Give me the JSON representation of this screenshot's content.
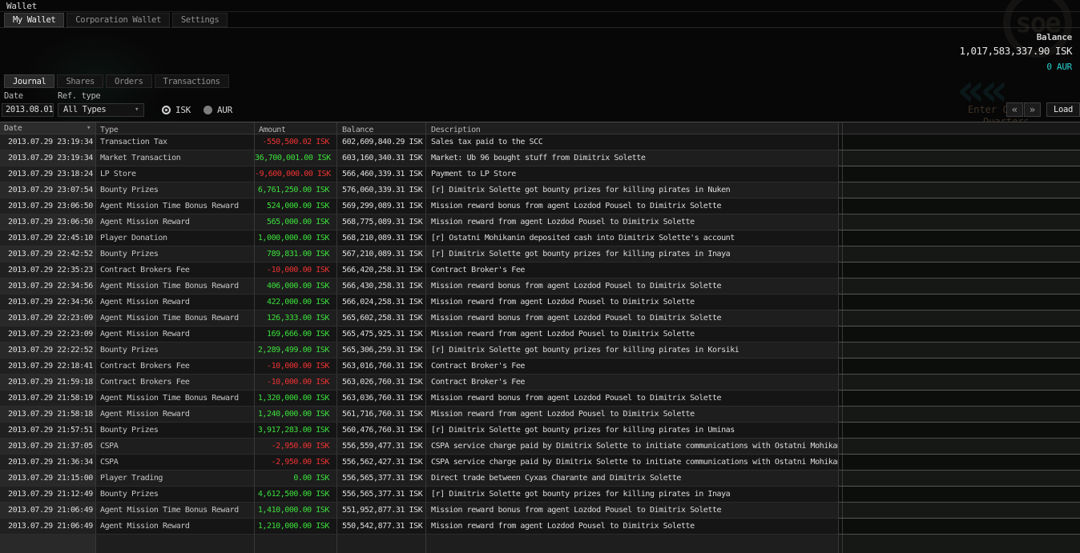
{
  "window_title": "Wallet",
  "main_tabs": [
    {
      "label": "My Wallet",
      "active": true
    },
    {
      "label": "Corporation Wallet",
      "active": false
    },
    {
      "label": "Settings",
      "active": false
    }
  ],
  "balance": {
    "label": "Balance",
    "isk": "1,017,583,337.90 ISK",
    "aur": "0 AUR"
  },
  "sub_tabs": [
    {
      "label": "Journal",
      "active": true
    },
    {
      "label": "Shares",
      "active": false
    },
    {
      "label": "Orders",
      "active": false
    },
    {
      "label": "Transactions",
      "active": false
    }
  ],
  "filters": {
    "date_label": "Date",
    "date_value": "2013.08.01",
    "ref_type_label": "Ref. type",
    "ref_type_value": "All Types",
    "currencies": [
      {
        "label": "ISK",
        "selected": true
      },
      {
        "label": "AUR",
        "selected": false
      }
    ],
    "load_button": "Load"
  },
  "icons": {
    "sort_desc": "▾",
    "dropdown_arrow": "▾",
    "pager_prev": "«",
    "pager_next": "»"
  },
  "background_scene": {
    "station_button_line1": "Enter Ca",
    "station_button_line2": "Quarters",
    "logo_text": "soe",
    "chevrons": "««"
  },
  "colors": {
    "positive": "#3be03b",
    "negative": "#f03232",
    "aur_accent": "#29cfcf"
  },
  "table": {
    "columns": [
      "Date",
      "Type",
      "Amount",
      "Balance",
      "Description"
    ],
    "rows": [
      {
        "date": "2013.07.29 23:19:34",
        "type": "Transaction Tax",
        "amount": "-550,500.02 ISK",
        "negative": true,
        "balance": "602,609,840.29 ISK",
        "description": "Sales tax paid to the SCC"
      },
      {
        "date": "2013.07.29 23:19:34",
        "type": "Market Transaction",
        "amount": "36,700,001.00 ISK",
        "negative": false,
        "balance": "603,160,340.31 ISK",
        "description": "Market: Ub 96 bought stuff from Dimitrix Solette"
      },
      {
        "date": "2013.07.29 23:18:24",
        "type": "LP Store",
        "amount": "-9,600,000.00 ISK",
        "negative": true,
        "balance": "566,460,339.31 ISK",
        "description": "Payment to LP Store"
      },
      {
        "date": "2013.07.29 23:07:54",
        "type": "Bounty Prizes",
        "amount": "6,761,250.00 ISK",
        "negative": false,
        "balance": "576,060,339.31 ISK",
        "description": "[r] Dimitrix Solette got bounty prizes for killing pirates in Nuken"
      },
      {
        "date": "2013.07.29 23:06:50",
        "type": "Agent Mission Time Bonus Reward",
        "amount": "524,000.00 ISK",
        "negative": false,
        "balance": "569,299,089.31 ISK",
        "description": "Mission reward bonus from agent Lozdod Pousel to Dimitrix Solette"
      },
      {
        "date": "2013.07.29 23:06:50",
        "type": "Agent Mission Reward",
        "amount": "565,000.00 ISK",
        "negative": false,
        "balance": "568,775,089.31 ISK",
        "description": "Mission reward from agent Lozdod Pousel to Dimitrix Solette"
      },
      {
        "date": "2013.07.29 22:45:10",
        "type": "Player Donation",
        "amount": "1,000,000.00 ISK",
        "negative": false,
        "balance": "568,210,089.31 ISK",
        "description": "[r] Ostatni Mohikanin deposited cash into Dimitrix Solette's account"
      },
      {
        "date": "2013.07.29 22:42:52",
        "type": "Bounty Prizes",
        "amount": "789,831.00 ISK",
        "negative": false,
        "balance": "567,210,089.31 ISK",
        "description": "[r] Dimitrix Solette got bounty prizes for killing pirates in Inaya"
      },
      {
        "date": "2013.07.29 22:35:23",
        "type": "Contract Brokers Fee",
        "amount": "-10,000.00 ISK",
        "negative": true,
        "balance": "566,420,258.31 ISK",
        "description": "Contract Broker's Fee"
      },
      {
        "date": "2013.07.29 22:34:56",
        "type": "Agent Mission Time Bonus Reward",
        "amount": "406,000.00 ISK",
        "negative": false,
        "balance": "566,430,258.31 ISK",
        "description": "Mission reward bonus from agent Lozdod Pousel to Dimitrix Solette"
      },
      {
        "date": "2013.07.29 22:34:56",
        "type": "Agent Mission Reward",
        "amount": "422,000.00 ISK",
        "negative": false,
        "balance": "566,024,258.31 ISK",
        "description": "Mission reward from agent Lozdod Pousel to Dimitrix Solette"
      },
      {
        "date": "2013.07.29 22:23:09",
        "type": "Agent Mission Time Bonus Reward",
        "amount": "126,333.00 ISK",
        "negative": false,
        "balance": "565,602,258.31 ISK",
        "description": "Mission reward bonus from agent Lozdod Pousel to Dimitrix Solette"
      },
      {
        "date": "2013.07.29 22:23:09",
        "type": "Agent Mission Reward",
        "amount": "169,666.00 ISK",
        "negative": false,
        "balance": "565,475,925.31 ISK",
        "description": "Mission reward from agent Lozdod Pousel to Dimitrix Solette"
      },
      {
        "date": "2013.07.29 22:22:52",
        "type": "Bounty Prizes",
        "amount": "2,289,499.00 ISK",
        "negative": false,
        "balance": "565,306,259.31 ISK",
        "description": "[r] Dimitrix Solette got bounty prizes for killing pirates in Korsiki"
      },
      {
        "date": "2013.07.29 22:18:41",
        "type": "Contract Brokers Fee",
        "amount": "-10,000.00 ISK",
        "negative": true,
        "balance": "563,016,760.31 ISK",
        "description": "Contract Broker's Fee"
      },
      {
        "date": "2013.07.29 21:59:18",
        "type": "Contract Brokers Fee",
        "amount": "-10,000.00 ISK",
        "negative": true,
        "balance": "563,026,760.31 ISK",
        "description": "Contract Broker's Fee"
      },
      {
        "date": "2013.07.29 21:58:19",
        "type": "Agent Mission Time Bonus Reward",
        "amount": "1,320,000.00 ISK",
        "negative": false,
        "balance": "563,036,760.31 ISK",
        "description": "Mission reward bonus from agent Lozdod Pousel to Dimitrix Solette"
      },
      {
        "date": "2013.07.29 21:58:18",
        "type": "Agent Mission Reward",
        "amount": "1,240,000.00 ISK",
        "negative": false,
        "balance": "561,716,760.31 ISK",
        "description": "Mission reward from agent Lozdod Pousel to Dimitrix Solette"
      },
      {
        "date": "2013.07.29 21:57:51",
        "type": "Bounty Prizes",
        "amount": "3,917,283.00 ISK",
        "negative": false,
        "balance": "560,476,760.31 ISK",
        "description": "[r] Dimitrix Solette got bounty prizes for killing pirates in Uminas"
      },
      {
        "date": "2013.07.29 21:37:05",
        "type": "CSPA",
        "amount": "-2,950.00 ISK",
        "negative": true,
        "balance": "556,559,477.31 ISK",
        "description": "CSPA service charge paid by Dimitrix Solette to initiate communications with Ostatni Mohikanin"
      },
      {
        "date": "2013.07.29 21:36:34",
        "type": "CSPA",
        "amount": "-2,950.00 ISK",
        "negative": true,
        "balance": "556,562,427.31 ISK",
        "description": "CSPA service charge paid by Dimitrix Solette to initiate communications with Ostatni Mohikanin"
      },
      {
        "date": "2013.07.29 21:15:00",
        "type": "Player Trading",
        "amount": "0.00 ISK",
        "negative": false,
        "balance": "556,565,377.31 ISK",
        "description": "Direct trade between Cyxas Charante and Dimitrix Solette"
      },
      {
        "date": "2013.07.29 21:12:49",
        "type": "Bounty Prizes",
        "amount": "4,612,500.00 ISK",
        "negative": false,
        "balance": "556,565,377.31 ISK",
        "description": "[r] Dimitrix Solette got bounty prizes for killing pirates in Inaya"
      },
      {
        "date": "2013.07.29 21:06:49",
        "type": "Agent Mission Time Bonus Reward",
        "amount": "1,410,000.00 ISK",
        "negative": false,
        "balance": "551,952,877.31 ISK",
        "description": "Mission reward bonus from agent Lozdod Pousel to Dimitrix Solette"
      },
      {
        "date": "2013.07.29 21:06:49",
        "type": "Agent Mission Reward",
        "amount": "1,210,000.00 ISK",
        "negative": false,
        "balance": "550,542,877.31 ISK",
        "description": "Mission reward from agent Lozdod Pousel to Dimitrix Solette"
      }
    ]
  }
}
